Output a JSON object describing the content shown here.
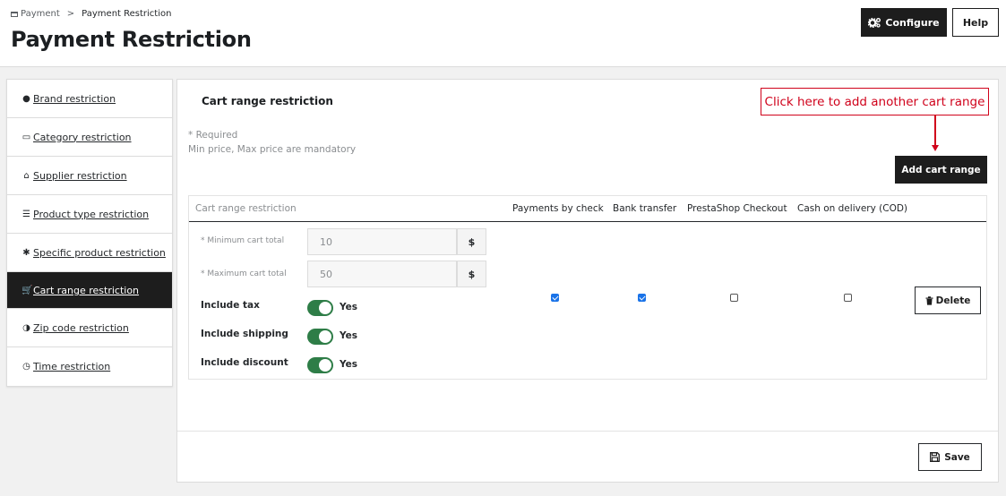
{
  "breadcrumb": {
    "parent": "Payment",
    "separator": ">",
    "current": "Payment Restriction"
  },
  "page_title": "Payment Restriction",
  "toolbar": {
    "configure_label": "Configure",
    "help_label": "Help"
  },
  "sidebar": {
    "items": [
      {
        "label": "Brand restriction",
        "icon": "user-icon",
        "active": false
      },
      {
        "label": "Category restriction",
        "icon": "credit-card-icon",
        "active": false
      },
      {
        "label": "Supplier restriction",
        "icon": "home-icon",
        "active": false
      },
      {
        "label": "Product type restriction",
        "icon": "list-icon",
        "active": false
      },
      {
        "label": "Specific product restriction",
        "icon": "asterisk-icon",
        "active": false
      },
      {
        "label": "Cart range restriction",
        "icon": "shopping-cart-icon",
        "active": true
      },
      {
        "label": "Zip code restriction",
        "icon": "half-circle-icon",
        "active": false
      },
      {
        "label": "Time restriction",
        "icon": "clock-icon",
        "active": false
      }
    ]
  },
  "panel": {
    "title": "Cart range restriction",
    "required_note": "* Required",
    "mandatory_note": "Min price, Max price are mandatory",
    "callout_text": "Click here to add another cart range",
    "add_button_label": "Add cart range",
    "save_label": "Save"
  },
  "table": {
    "headers": [
      "Cart range restriction",
      "Payments by check",
      "Bank transfer",
      "PrestaShop Checkout",
      "Cash on delivery (COD)"
    ],
    "row": {
      "min_label": "* Minimum cart total",
      "min_value": "10",
      "max_label": "* Maximum cart total",
      "max_value": "50",
      "currency": "$",
      "include_tax_label": "Include tax",
      "include_tax_value": "Yes",
      "include_shipping_label": "Include shipping",
      "include_shipping_value": "Yes",
      "include_discount_label": "Include discount",
      "include_discount_value": "Yes",
      "payments_by_check": true,
      "bank_transfer": true,
      "prestashop_checkout": false,
      "cash_on_delivery": false,
      "delete_label": "Delete"
    }
  },
  "colors": {
    "accent_dark": "#1d1d1d",
    "toggle_on": "#2e7d47",
    "callout_red": "#d0021b",
    "checkbox_blue": "#1a73e8"
  }
}
